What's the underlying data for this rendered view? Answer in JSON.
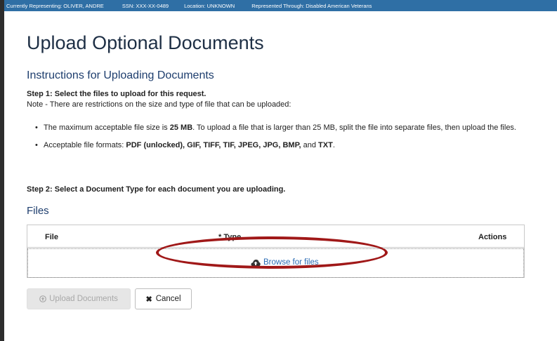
{
  "representation_bar": {
    "currently_representing": "Currently Representing:  OLIVER, ANDRE",
    "ssn": "SSN:  XXX-XX-0489",
    "location": "Location:  UNKNOWN",
    "represented_through": "Represented Through:  Disabled American Veterans"
  },
  "page": {
    "title": "Upload Optional Documents",
    "instructions_heading": "Instructions for Uploading Documents",
    "step1": "Step 1: Select the files to upload for this request.",
    "note": "Note - There are restrictions on the size and type of file that can be uploaded:",
    "rule_size": {
      "prefix": "The maximum acceptable file size is ",
      "limit": "25 MB",
      "suffix": ". To upload a file that is larger than 25 MB, split the file into separate files, then upload the files."
    },
    "rule_formats": {
      "prefix": "Acceptable file formats: ",
      "formats": "PDF (unlocked), GIF, TIFF, TIF, JPEG, JPG, BMP,",
      "and": " and ",
      "last": "TXT",
      "end": "."
    },
    "step2": "Step 2: Select a Document Type for each document you are uploading."
  },
  "files": {
    "heading": "Files",
    "columns": [
      "File",
      "* Type",
      "Actions"
    ],
    "browse_label": "Browse for files",
    "browse_icon": "cloud-upload-icon"
  },
  "actions": {
    "upload_label": "Upload Documents",
    "upload_icon": "upload-circle-icon",
    "cancel_label": "Cancel",
    "cancel_icon": "x-icon"
  },
  "colors": {
    "topbar": "#2f6fa5",
    "link": "#2a6bb4",
    "highlight_ring": "#a01818",
    "title": "#1e2f45"
  }
}
